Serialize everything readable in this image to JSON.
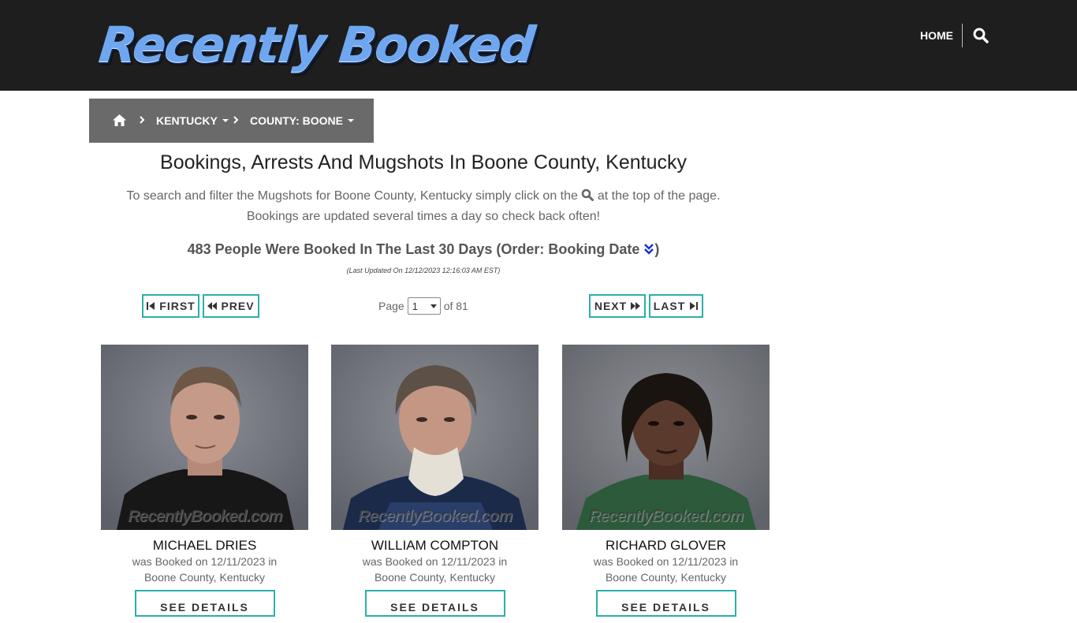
{
  "header": {
    "logo_text": "Recently Booked",
    "nav_home": "HOME",
    "search_icon": "search-icon"
  },
  "breadcrumb": {
    "home_icon": "home-icon",
    "state": "KENTUCKY",
    "county": "COUNTY: BOONE"
  },
  "main": {
    "title": "Bookings, Arrests And Mugshots In Boone County, Kentucky",
    "intro_part1": "To search and filter the Mugshots for Boone County, Kentucky simply click on the",
    "intro_part2": "at the top of the page.",
    "intro_line2": "Bookings are updated several times a day so check back often!",
    "count_text": "483 People Were Booked In The Last 30 Days (Order: Booking Date",
    "count_close": ")",
    "updated": "(Last Updated On 12/12/2023 12:16:03 AM EST)"
  },
  "pagination": {
    "first": "FIRST",
    "prev": "PREV",
    "next": "NEXT",
    "last": "LAST",
    "page_label": "Page",
    "current_page": "1",
    "of_label": "of 81"
  },
  "people": [
    {
      "name": "MICHAEL DRIES",
      "booked": "was Booked on 12/11/2023 in",
      "location": "Boone County, Kentucky",
      "watermark": "RecentlyBooked.com",
      "button": "SEE DETAILS"
    },
    {
      "name": "WILLIAM COMPTON",
      "booked": "was Booked on 12/11/2023 in",
      "location": "Boone County, Kentucky",
      "watermark": "RecentlyBooked.com",
      "button": "SEE DETAILS"
    },
    {
      "name": "RICHARD GLOVER",
      "booked": "was Booked on 12/11/2023 in",
      "location": "Boone County, Kentucky",
      "watermark": "RecentlyBooked.com",
      "button": "SEE DETAILS"
    }
  ],
  "colors": {
    "header_bg": "#1e1e1e",
    "breadcrumb_bg": "#6a6a6a",
    "button_border": "#2bb0a8",
    "logo_blue": "#6fa6f0"
  }
}
